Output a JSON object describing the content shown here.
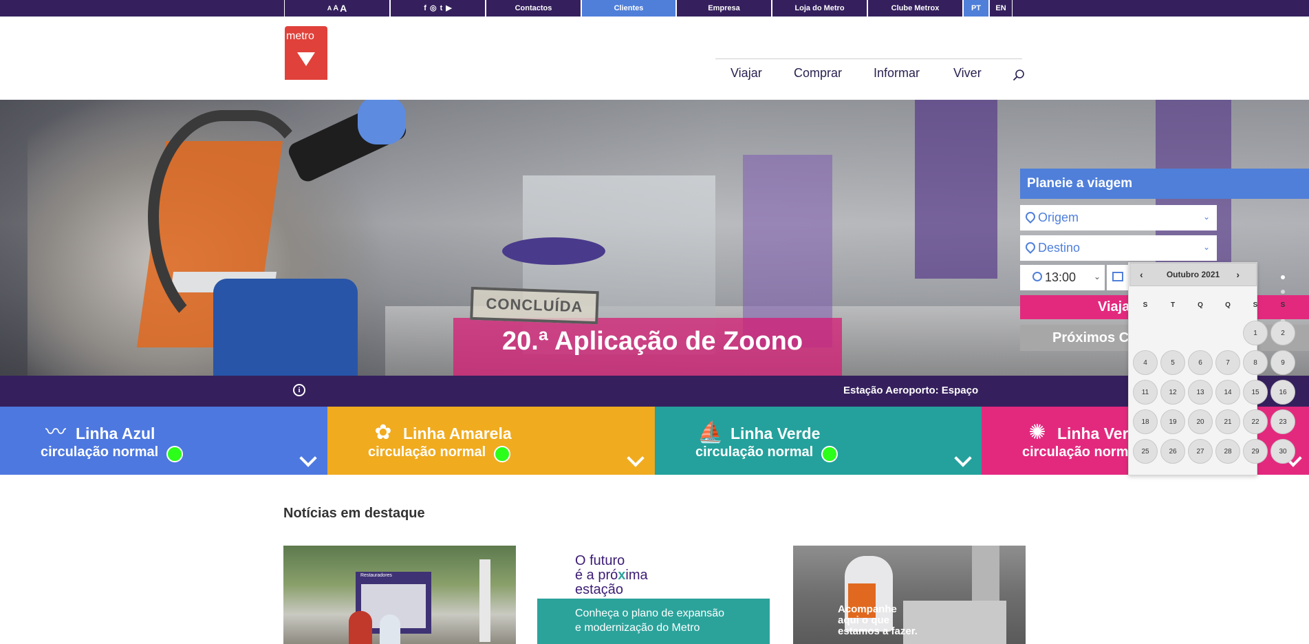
{
  "topbar": {
    "font_sizes": {
      "small": "A",
      "medium": "A",
      "large": "A"
    },
    "social_icons": [
      "facebook-icon",
      "instagram-icon",
      "twitter-icon",
      "youtube-icon"
    ],
    "social_glyphs": {
      "facebook": "f",
      "instagram": "◎",
      "twitter": "t",
      "youtube": "▶"
    },
    "links": {
      "contactos": "Contactos",
      "clientes": "Clientes",
      "empresa": "Empresa",
      "loja": "Loja do Metro",
      "clube": "Clube Metrox"
    },
    "languages": {
      "pt": "PT",
      "en": "EN"
    },
    "active_link": "Clientes",
    "active_language": "PT"
  },
  "logo": {
    "text": "metro"
  },
  "nav": {
    "viajar": "Viajar",
    "comprar": "Comprar",
    "informar": "Informar",
    "viver": "Viver"
  },
  "hero": {
    "stamp": "CONCLUÍDA",
    "title": "20.ª Aplicação de Zoono",
    "slides": 5,
    "active_slide": 1
  },
  "planner": {
    "title": "Planeie a viagem",
    "origin_placeholder": "Origem",
    "destination_placeholder": "Destino",
    "time": "13:00",
    "submit_label": "Viaja",
    "next_label": "Próximos C"
  },
  "datepicker": {
    "month_label": "Outubro 2021",
    "weekdays": [
      "S",
      "T",
      "Q",
      "Q",
      "S",
      "S"
    ],
    "days": [
      [
        "",
        "",
        "",
        "",
        "1",
        "2"
      ],
      [
        "4",
        "5",
        "6",
        "7",
        "8",
        "9"
      ],
      [
        "11",
        "12",
        "13",
        "14",
        "15",
        "16"
      ],
      [
        "18",
        "19",
        "20",
        "21",
        "22",
        "23"
      ],
      [
        "25",
        "26",
        "27",
        "28",
        "29",
        "30"
      ]
    ]
  },
  "infobar": {
    "message": "Estação Aeroporto: Espaço"
  },
  "lines": [
    {
      "name": "Linha Azul",
      "status": "circulação normal",
      "color": "#4d78e0",
      "icon": "seagull-icon"
    },
    {
      "name": "Linha Amarela",
      "status": "circulação normal",
      "color": "#f0ab1f",
      "icon": "sunflower-icon"
    },
    {
      "name": "Linha Verde",
      "status": "circulação normal",
      "color": "#24a19c",
      "icon": "caravel-icon"
    },
    {
      "name": "Linha Vermelha",
      "status": "circulação normal",
      "color": "#e3297e",
      "icon": "compass-rose-icon"
    }
  ],
  "news": {
    "title": "Notícias em destaque",
    "card1_sign": "Restauradores",
    "card2_headline": [
      "O futuro",
      "é a próxima",
      "estação"
    ],
    "card2_caption": [
      "Conheça o plano de expansão",
      "e modernização do Metro"
    ],
    "card3_caption": [
      "Acompanhe",
      "aqui o que",
      "estamos a fazer."
    ]
  },
  "colors": {
    "purple": "#35205d",
    "blue": "#4f7fd9",
    "pink": "#e3297e",
    "logo_red": "#e0413a",
    "status_green": "#2bff1a"
  }
}
